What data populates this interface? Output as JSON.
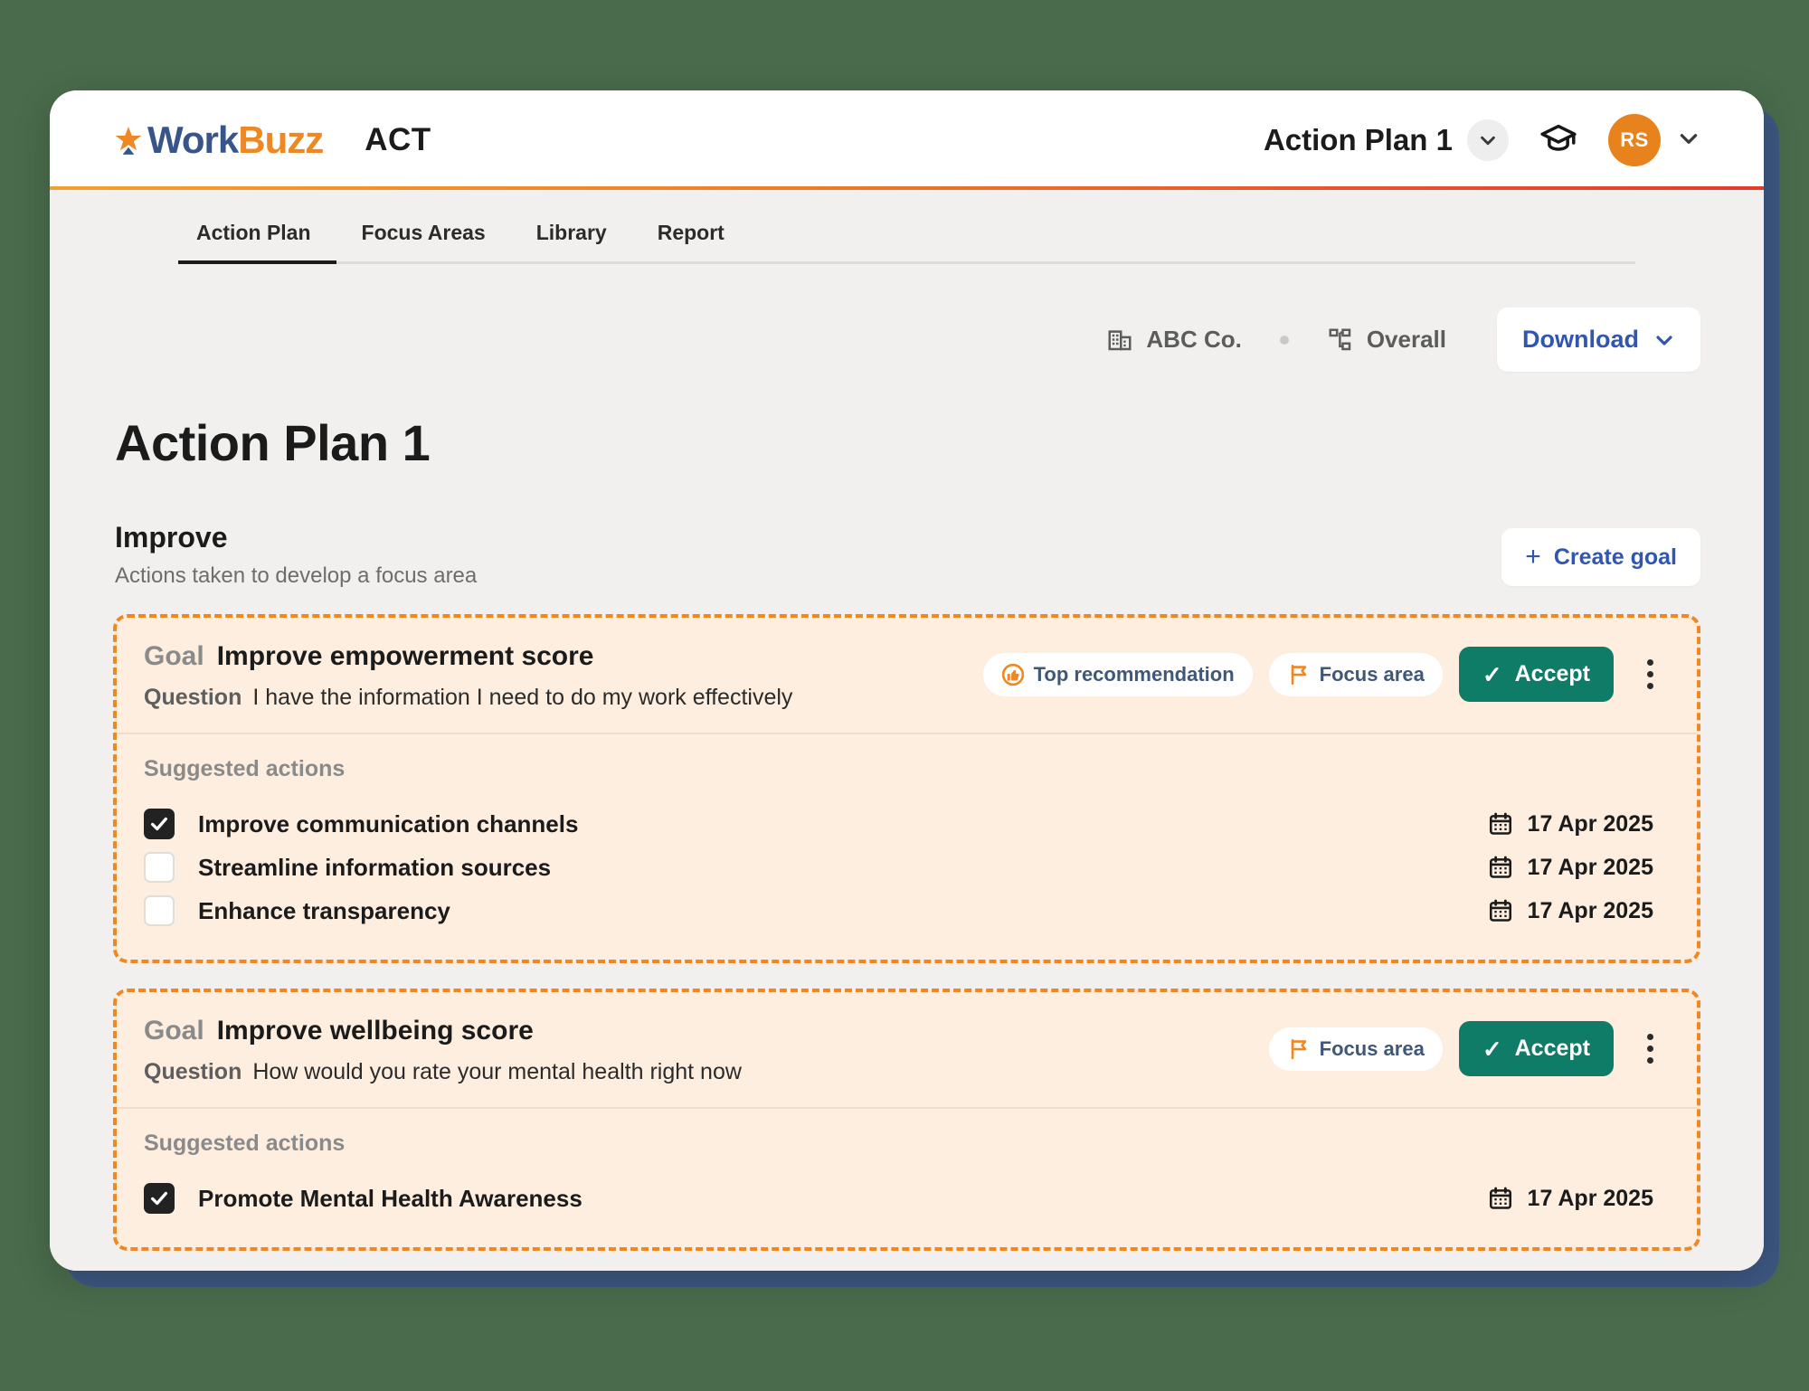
{
  "brand": {
    "logo_work": "Work",
    "logo_buzz": "Buzz",
    "app_name": "ACT"
  },
  "topbar": {
    "plan_switcher_label": "Action Plan 1",
    "avatar_initials": "RS"
  },
  "tabs": [
    {
      "label": "Action Plan",
      "active": true
    },
    {
      "label": "Focus Areas",
      "active": false
    },
    {
      "label": "Library",
      "active": false
    },
    {
      "label": "Report",
      "active": false
    }
  ],
  "meta": {
    "company": "ABC Co.",
    "scope": "Overall",
    "download_label": "Download"
  },
  "page": {
    "title": "Action Plan 1",
    "section_title": "Improve",
    "section_subtitle": "Actions taken to develop a focus area",
    "create_goal_label": "Create goal",
    "plus_glyph": "+"
  },
  "labels": {
    "goal": "Goal",
    "question": "Question",
    "suggested_actions": "Suggested actions",
    "accept": "Accept",
    "accept_check": "✓",
    "badge_top_recommendation": "Top recommendation",
    "badge_focus_area": "Focus area"
  },
  "goals": [
    {
      "name": "Improve empowerment score",
      "question": "I have the information I need to do my work effectively",
      "badges": [
        "Top recommendation",
        "Focus area"
      ],
      "accept_label": "Accept",
      "suggested_title": "Suggested actions",
      "actions": [
        {
          "label": "Improve communication channels",
          "checked": true,
          "date": "17 Apr 2025"
        },
        {
          "label": "Streamline information sources",
          "checked": false,
          "date": "17 Apr 2025"
        },
        {
          "label": "Enhance transparency",
          "checked": false,
          "date": "17 Apr 2025"
        }
      ]
    },
    {
      "name": "Improve wellbeing score",
      "question": "How would you rate your mental health right now",
      "badges": [
        "Focus area"
      ],
      "accept_label": "Accept",
      "suggested_title": "Suggested actions",
      "actions": [
        {
          "label": "Promote Mental Health Awareness",
          "checked": true,
          "date": "17 Apr 2025"
        }
      ]
    }
  ],
  "colors": {
    "background": "#4a6b4c",
    "plate": "#3d5780",
    "brand_orange": "#ef8722",
    "brand_blue": "#38558a",
    "accent_blue": "#3056b0",
    "accept_teal": "#0e7c66",
    "card_bg": "#fdeedf",
    "avatar_orange": "#e8821c"
  }
}
